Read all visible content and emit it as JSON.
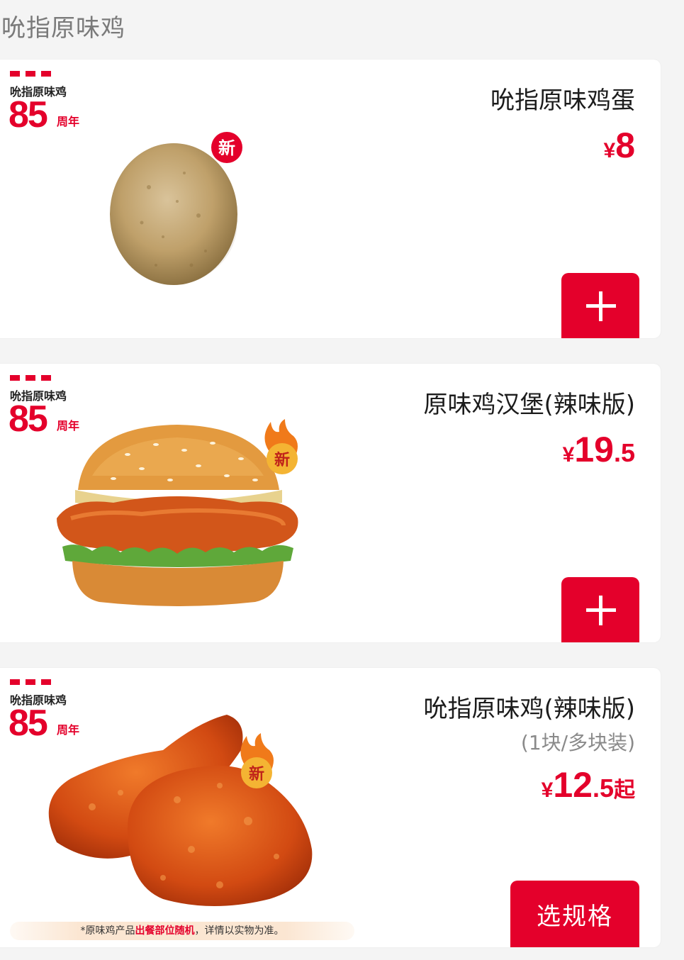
{
  "section": {
    "title": "吮指原味鸡"
  },
  "badge": {
    "text": "吮指原味鸡",
    "number": "85",
    "suffix": "周年"
  },
  "products": [
    {
      "name": "吮指原味鸡蛋",
      "price": {
        "currency": "¥",
        "integer": "8",
        "decimal": "",
        "suffix": ""
      },
      "tag": "新",
      "action": "+"
    },
    {
      "name": "原味鸡汉堡(辣味版)",
      "price": {
        "currency": "¥",
        "integer": "19",
        "decimal": ".5",
        "suffix": ""
      },
      "tag": "新",
      "action": "+"
    },
    {
      "name": "吮指原味鸡(辣味版)",
      "sub": "(1块/多块装)",
      "price": {
        "currency": "¥",
        "integer": "12",
        "decimal": ".5",
        "suffix": "起"
      },
      "tag": "新",
      "action": "选规格",
      "disclaimer": {
        "pre": "*原味鸡产品",
        "highlight": "出餐部位随机",
        "post": "，详情以实物为准。"
      }
    }
  ],
  "colors": {
    "brand": "#e4002b",
    "background": "#f4f4f4",
    "card": "#ffffff"
  }
}
